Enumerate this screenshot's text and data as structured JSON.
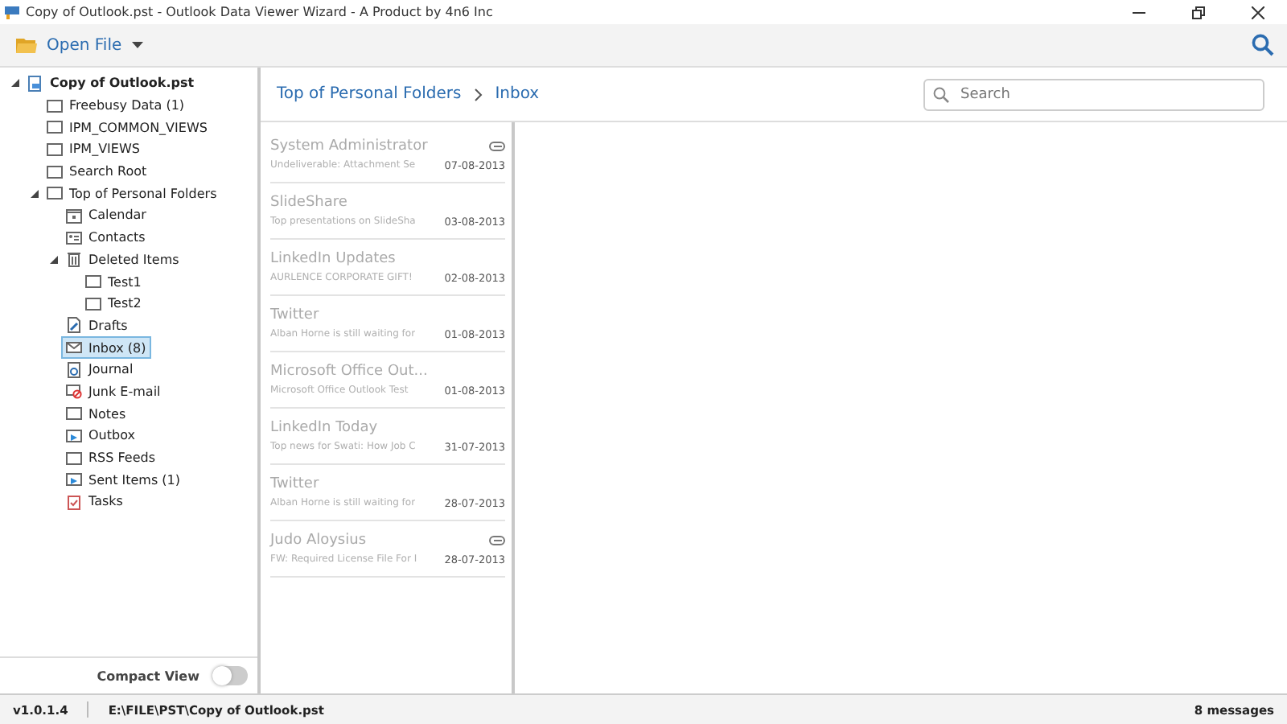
{
  "window": {
    "title": "Copy of Outlook.pst - Outlook Data Viewer Wizard - A Product by 4n6 Inc"
  },
  "toolbar": {
    "open_file": "Open File"
  },
  "tree": [
    {
      "label": "Copy of Outlook.pst",
      "kind": "pst",
      "bold": true,
      "expanded": true,
      "selected": false,
      "children": [
        {
          "label": "Freebusy Data (1)",
          "kind": "folder",
          "selected": false
        },
        {
          "label": "IPM_COMMON_VIEWS",
          "kind": "folder",
          "selected": false
        },
        {
          "label": "IPM_VIEWS",
          "kind": "folder",
          "selected": false
        },
        {
          "label": "Search Root",
          "kind": "folder",
          "selected": false
        },
        {
          "label": "Top of Personal Folders",
          "kind": "folder",
          "expanded": true,
          "selected": false,
          "children": [
            {
              "label": "Calendar",
              "kind": "calendar",
              "selected": false
            },
            {
              "label": "Contacts",
              "kind": "contacts",
              "selected": false
            },
            {
              "label": "Deleted Items",
              "kind": "trash",
              "expanded": true,
              "selected": false,
              "children": [
                {
                  "label": "Test1",
                  "kind": "folder",
                  "selected": false
                },
                {
                  "label": "Test2",
                  "kind": "folder",
                  "selected": false
                }
              ]
            },
            {
              "label": "Drafts",
              "kind": "drafts",
              "selected": false
            },
            {
              "label": "Inbox (8)",
              "kind": "inbox",
              "selected": true
            },
            {
              "label": "Journal",
              "kind": "journal",
              "selected": false
            },
            {
              "label": "Junk E-mail",
              "kind": "junk",
              "selected": false
            },
            {
              "label": "Notes",
              "kind": "folder",
              "selected": false
            },
            {
              "label": "Outbox",
              "kind": "outbox",
              "selected": false
            },
            {
              "label": "RSS Feeds",
              "kind": "folder",
              "selected": false
            },
            {
              "label": "Sent Items (1)",
              "kind": "outbox",
              "selected": false
            },
            {
              "label": "Tasks",
              "kind": "tasks",
              "selected": false
            }
          ]
        }
      ]
    }
  ],
  "compact_view": {
    "label": "Compact View",
    "on": false
  },
  "breadcrumb": [
    "Top of Personal Folders",
    "Inbox"
  ],
  "search": {
    "placeholder": "Search"
  },
  "messages": [
    {
      "sender": "System Administrator",
      "subject": "Undeliverable: Attachment Se",
      "date": "07-08-2013",
      "attachment": true
    },
    {
      "sender": "SlideShare",
      "subject": "Top presentations on SlideSha",
      "date": "03-08-2013",
      "attachment": false
    },
    {
      "sender": "LinkedIn Updates",
      "subject": "AURLENCE CORPORATE GIFT!",
      "date": "02-08-2013",
      "attachment": false
    },
    {
      "sender": "Twitter",
      "subject": "Alban Horne is still waiting for",
      "date": "01-08-2013",
      "attachment": false
    },
    {
      "sender": "Microsoft Office Out...",
      "subject": "Microsoft Office Outlook Test",
      "date": "01-08-2013",
      "attachment": false
    },
    {
      "sender": "LinkedIn Today",
      "subject": "Top news for Swati: How Job C",
      "date": "31-07-2013",
      "attachment": false
    },
    {
      "sender": "Twitter",
      "subject": "Alban Horne is still waiting for",
      "date": "28-07-2013",
      "attachment": false
    },
    {
      "sender": "Judo Aloysius",
      "subject": "FW: Required License File For I",
      "date": "28-07-2013",
      "attachment": true
    }
  ],
  "status_bar": {
    "version": "v1.0.1.4",
    "path": "E:\\FILE\\PST\\Copy of Outlook.pst",
    "count": "8 messages"
  }
}
